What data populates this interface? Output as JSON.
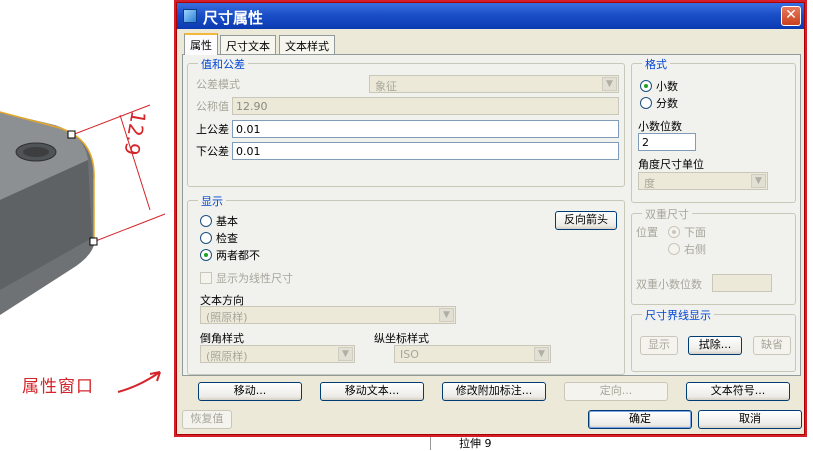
{
  "annotation_text": "属性窗口",
  "tree_item": "拉伸 9",
  "dialog": {
    "title": "尺寸属性",
    "close_glyph": "✕"
  },
  "tabs": [
    "属性",
    "尺寸文本",
    "文本样式"
  ],
  "values_group": {
    "label": "值和公差",
    "tolerance_mode_label": "公差模式",
    "tolerance_mode_value": "象征",
    "nominal_label": "公称值",
    "nominal_value": "12.90",
    "upper_label": "上公差",
    "upper_value": "0.01",
    "lower_label": "下公差",
    "lower_value": "0.01"
  },
  "format_group": {
    "label": "格式",
    "decimal_label": "小数",
    "fraction_label": "分数",
    "decimals_label": "小数位数",
    "decimals_value": "2",
    "angle_unit_label": "角度尺寸单位",
    "angle_unit_value": "度"
  },
  "display_group": {
    "label": "显示",
    "basic_label": "基本",
    "inspect_label": "检查",
    "neither_label": "两者都不",
    "flip_arrows_label": "反向箭头",
    "linear_label": "显示为线性尺寸",
    "text_dir_label": "文本方向",
    "text_dir_value": "(照原样)",
    "chamfer_label": "倒角样式",
    "chamfer_value": "(照原样)",
    "ordinate_label": "纵坐标样式",
    "ordinate_value": "ISO"
  },
  "dual_group": {
    "label": "双重尺寸",
    "position_label": "位置",
    "below_label": "下面",
    "right_label": "右侧",
    "dual_decimals_label": "双重小数位数"
  },
  "witness_group": {
    "label": "尺寸界线显示",
    "show_label": "显示",
    "erase_label": "拭除...",
    "default_label": "缺省"
  },
  "bottom": {
    "move_label": "移动...",
    "move_text_label": "移动文本...",
    "modify_attach_label": "修改附加标注...",
    "orient_label": "定向...",
    "text_symbol_label": "文本符号...",
    "restore_label": "恢复值",
    "ok_label": "确定",
    "cancel_label": "取消"
  },
  "colors": {
    "accent_red": "#d41e2a",
    "title_blue": "#1a4fc8",
    "group_blue": "#0046d5"
  }
}
